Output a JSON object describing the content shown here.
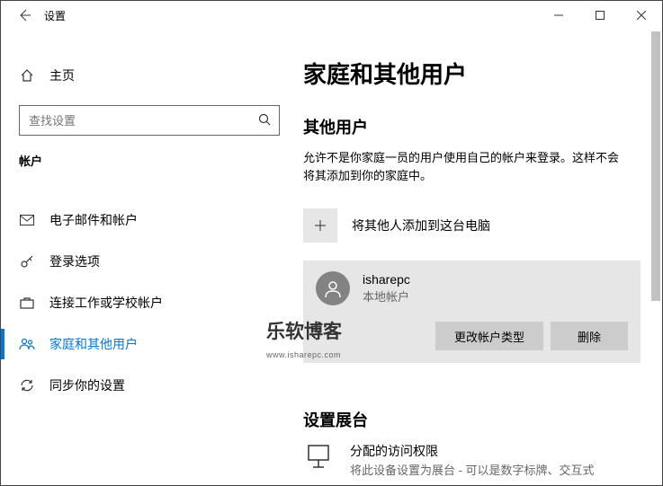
{
  "titlebar": {
    "title": "设置"
  },
  "sidebar": {
    "home_label": "主页",
    "search_placeholder": "查找设置",
    "section_header": "帐户",
    "items": [
      {
        "label": "电子邮件和帐户"
      },
      {
        "label": "登录选项"
      },
      {
        "label": "连接工作或学校帐户"
      },
      {
        "label": "家庭和其他用户"
      },
      {
        "label": "同步你的设置"
      }
    ]
  },
  "content": {
    "heading": "家庭和其他用户",
    "other_users_heading": "其他用户",
    "other_users_desc": "允许不是你家庭一员的用户使用自己的帐户来登录。这样不会将其添加到你的家庭中。",
    "add_label": "将其他人添加到这台电脑",
    "user": {
      "name": "isharepc",
      "type": "本地帐户",
      "change_type_btn": "更改帐户类型",
      "delete_btn": "删除"
    },
    "kiosk_heading": "设置展台",
    "kiosk": {
      "title": "分配的访问权限",
      "sub": "将此设备设置为展台 - 可以是数字标牌、交互式"
    }
  },
  "watermark": {
    "main": "乐软博客",
    "sub": "www.isharepc.com"
  }
}
